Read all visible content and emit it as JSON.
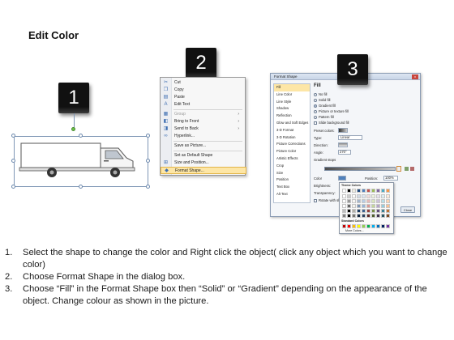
{
  "title": "Edit Color",
  "step_badges": [
    "1",
    "2",
    "3"
  ],
  "context_menu": {
    "items": [
      {
        "icon": "cut-icon",
        "glyph": "✂",
        "label": "Cut",
        "submenu": false
      },
      {
        "icon": "copy-icon",
        "glyph": "❐",
        "label": "Copy",
        "submenu": false
      },
      {
        "icon": "paste-icon",
        "glyph": "▤",
        "label": "Paste",
        "submenu": false
      },
      {
        "icon": "edit-text-icon",
        "glyph": "A",
        "label": "Edit Text",
        "submenu": false
      },
      {
        "icon": "group-icon",
        "glyph": "▦",
        "label": "Group",
        "submenu": true
      },
      {
        "icon": "bring-front-icon",
        "glyph": "◧",
        "label": "Bring to Front",
        "submenu": true
      },
      {
        "icon": "send-back-icon",
        "glyph": "◨",
        "label": "Send to Back",
        "submenu": true
      },
      {
        "icon": "hyperlink-icon",
        "glyph": "∞",
        "label": "Hyperlink...",
        "submenu": false
      },
      {
        "icon": "save-picture-icon",
        "glyph": "",
        "label": "Save as Picture...",
        "submenu": false
      },
      {
        "icon": "default-shape-icon",
        "glyph": "",
        "label": "Set as Default Shape",
        "submenu": false
      },
      {
        "icon": "size-position-icon",
        "glyph": "⊞",
        "label": "Size and Position...",
        "submenu": false
      },
      {
        "icon": "format-shape-icon",
        "glyph": "◆",
        "label": "Format Shape...",
        "submenu": false
      }
    ]
  },
  "dialog": {
    "title": "Format Shape",
    "close_glyph": "x",
    "categories": [
      "Fill",
      "Line Color",
      "Line Style",
      "Shadow",
      "Reflection",
      "Glow and Soft Edges",
      "3-D Format",
      "3-D Rotation",
      "Picture Corrections",
      "Picture Color",
      "Artistic Effects",
      "Crop",
      "Size",
      "Position",
      "Text Box",
      "Alt Text"
    ],
    "selected_category": "Fill",
    "section_heading": "Fill",
    "fill_options": [
      {
        "label": "No fill",
        "selected": false
      },
      {
        "label": "Solid fill",
        "selected": false
      },
      {
        "label": "Gradient fill",
        "selected": true
      },
      {
        "label": "Picture or texture fill",
        "selected": false
      },
      {
        "label": "Pattern fill",
        "selected": false
      }
    ],
    "slide_background_fill": "Slide background fill",
    "preset_colors_label": "Preset colors:",
    "type_label": "Type:",
    "type_value": "Linear",
    "direction_label": "Direction:",
    "angle_label": "Angle:",
    "angle_value": "270°",
    "gradient_stops_label": "Gradient stops",
    "color_label": "Color",
    "position_label": "Position:",
    "position_value": "100%",
    "brightness_label": "Brightness:",
    "transparency_label": "Transparency:",
    "rotate_label": "Rotate with shape",
    "close_button": "Close"
  },
  "palette": {
    "theme_label": "Theme Colors",
    "standard_label": "Standard Colors",
    "more_label": "More Colors...",
    "theme_top": [
      "#ffffff",
      "#000000",
      "#eeece1",
      "#1f497d",
      "#4f81bd",
      "#c0504d",
      "#9bbb59",
      "#8064a2",
      "#4bacc6",
      "#f79646"
    ],
    "standard": [
      "#c00000",
      "#ff0000",
      "#ffc000",
      "#ffff00",
      "#92d050",
      "#00b050",
      "#00b0f0",
      "#0070c0",
      "#002060",
      "#7030a0"
    ]
  },
  "steps": [
    {
      "num": "1.",
      "text": "Select the shape to change the color and Right click the object( click any object which you want to change color)"
    },
    {
      "num": "2.",
      "text": "Choose Format Shape in the dialog box."
    },
    {
      "num": "3.",
      "text": "Choose “Fill” in the Format Shape box then “Solid” or “Gradient” depending on the appearance of the object. Change colour as shown in the picture."
    }
  ]
}
